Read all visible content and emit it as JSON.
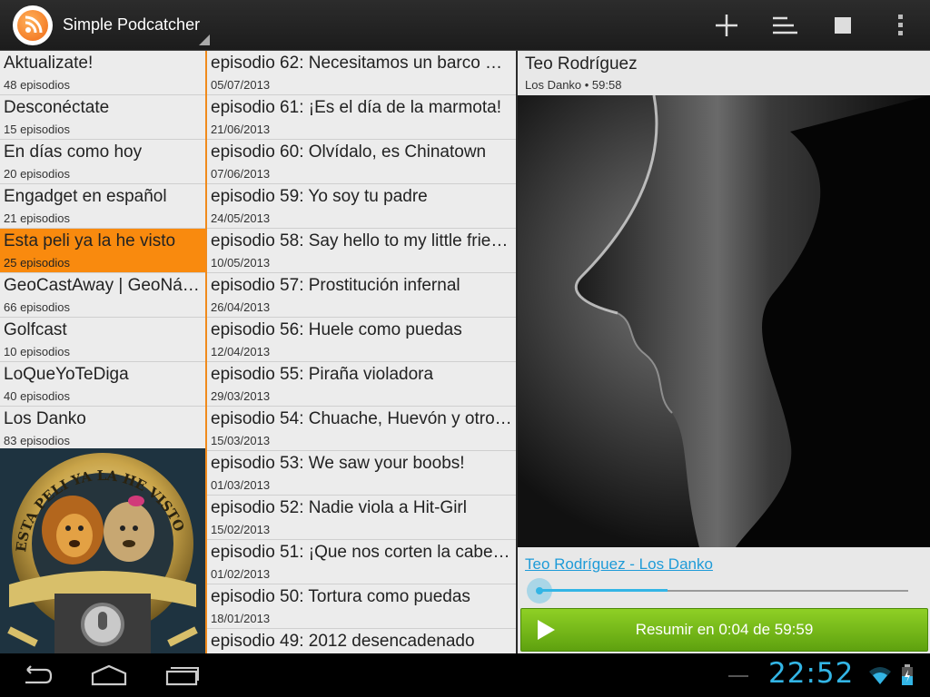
{
  "app": {
    "title": "Simple Podcatcher"
  },
  "toolbar": {
    "icons": [
      "plus-icon",
      "sort-icon",
      "stop-icon",
      "overflow-menu-icon"
    ]
  },
  "podcasts": [
    {
      "name": "Aktualizate!",
      "count": "48 episodios"
    },
    {
      "name": "Desconéctate",
      "count": "15 episodios"
    },
    {
      "name": "En días como hoy",
      "count": "20 episodios"
    },
    {
      "name": "Engadget en español",
      "count": "21 episodios"
    },
    {
      "name": "Esta peli ya la he visto",
      "count": "25 episodios",
      "selected": true
    },
    {
      "name": "GeoCastAway | GeoNá…",
      "count": "66 episodios"
    },
    {
      "name": "Golfcast",
      "count": "10 episodios"
    },
    {
      "name": "LoQueYoTeDiga",
      "count": "40 episodios"
    },
    {
      "name": "Los Danko",
      "count": "83 episodios"
    }
  ],
  "podcast_art": {
    "text": "ESTA PELI YA LA HE VISTO"
  },
  "episodes": [
    {
      "title": "episodio 62: Necesitamos un barco …",
      "date": "05/07/2013"
    },
    {
      "title": "episodio 61: ¡Es el día de la marmota!",
      "date": "21/06/2013"
    },
    {
      "title": "episodio 60: Olvídalo, es Chinatown",
      "date": "07/06/2013"
    },
    {
      "title": "episodio 59: Yo soy tu padre",
      "date": "24/05/2013"
    },
    {
      "title": "episodio 58: Say hello to my little frie…",
      "date": "10/05/2013"
    },
    {
      "title": "episodio 57: Prostitución infernal",
      "date": "26/04/2013"
    },
    {
      "title": "episodio 56: Huele como puedas",
      "date": "12/04/2013"
    },
    {
      "title": "episodio 55: Piraña violadora",
      "date": "29/03/2013"
    },
    {
      "title": "episodio 54: Chuache, Huevón y otro…",
      "date": "15/03/2013"
    },
    {
      "title": "episodio 53: We saw your boobs!",
      "date": "01/03/2013"
    },
    {
      "title": "episodio 52: Nadie viola a Hit-Girl",
      "date": "15/02/2013"
    },
    {
      "title": "episodio 51: ¡Que nos corten la cabe…",
      "date": "01/02/2013"
    },
    {
      "title": "episodio 50: Tortura como puedas",
      "date": "18/01/2013"
    },
    {
      "title": "episodio 49: 2012 desencadenado",
      "date": ""
    }
  ],
  "player": {
    "title": "Teo Rodríguez",
    "subtitle": "Los Danko • 59:58",
    "link": "Teo Rodríguez - Los Danko",
    "progress_fraction": 0.35,
    "button_label": "Resumir en 0:04 de 59:59"
  },
  "system": {
    "clock": "22:52"
  },
  "colors": {
    "accent_orange": "#f98a0e",
    "holo_blue": "#33b5e5",
    "play_green": "#6fb516"
  }
}
